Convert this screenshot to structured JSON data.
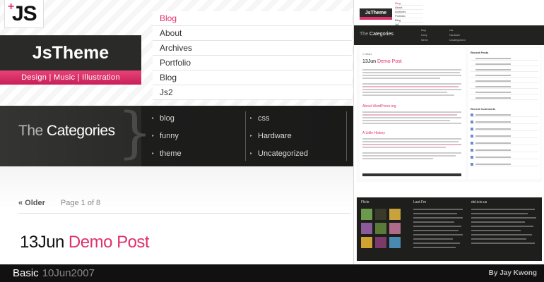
{
  "logo": {
    "plus": "+",
    "text": "JS"
  },
  "site": {
    "title": "JsTheme",
    "tagline": "Design | Music | Illustration"
  },
  "nav": {
    "items": [
      "Blog",
      "About",
      "Archives",
      "Portfolio",
      "Blog",
      "Js2"
    ]
  },
  "categories": {
    "heading_light": "The",
    "heading_bold": "Categories",
    "brace": "}",
    "bullet": "▸",
    "col1": [
      "blog",
      "funny",
      "theme"
    ],
    "col2": [
      "css",
      "Hardware",
      "Uncategorized"
    ]
  },
  "pager": {
    "older": "« Older",
    "page_info": "Page 1 of 8"
  },
  "post": {
    "date": "13Jun",
    "title": "Demo Post"
  },
  "thumbnail": {
    "title": "JsTheme",
    "nav": [
      "Blog",
      "About",
      "Archives",
      "Portfolio",
      "Blog",
      "Js2"
    ],
    "cat_light": "The",
    "cat_bold": "Categories",
    "older": "« Older",
    "post_date": "13Jun",
    "post_title": "Demo Post",
    "sub1": "About WordPress.org",
    "sub2": "A Little History",
    "side_head1": "Recent Posts",
    "side_head2": "Recent Comments",
    "footer_flickr": "Flickr",
    "footer_lastfm": "Last.Fm",
    "footer_delicious": "del.icio.us",
    "flickr_colors": [
      "#6b9a4a",
      "#3a3a2a",
      "#c8a23a",
      "#8a5a9a",
      "#5a7a3a",
      "#b06a8a",
      "#d0a030",
      "#7a3a6a",
      "#4a8ab0"
    ]
  },
  "footer": {
    "theme": "Basic",
    "date": "10Jun2007",
    "author": "By Jay Kwong"
  }
}
